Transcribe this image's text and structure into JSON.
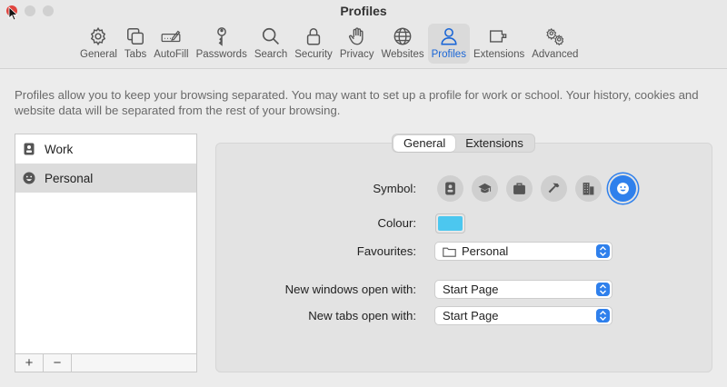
{
  "window": {
    "title": "Profiles"
  },
  "toolbar": {
    "items": [
      {
        "label": "General",
        "icon": "gear-icon"
      },
      {
        "label": "Tabs",
        "icon": "tabs-icon"
      },
      {
        "label": "AutoFill",
        "icon": "pencil-field-icon"
      },
      {
        "label": "Passwords",
        "icon": "key-icon"
      },
      {
        "label": "Search",
        "icon": "magnifier-icon"
      },
      {
        "label": "Security",
        "icon": "lock-icon"
      },
      {
        "label": "Privacy",
        "icon": "hand-icon"
      },
      {
        "label": "Websites",
        "icon": "globe-icon"
      },
      {
        "label": "Profiles",
        "icon": "person-icon"
      },
      {
        "label": "Extensions",
        "icon": "puzzle-icon"
      },
      {
        "label": "Advanced",
        "icon": "gears-icon"
      }
    ],
    "active": "Profiles"
  },
  "description": "Profiles allow you to keep your browsing separated. You may want to set up a profile for work or school. Your history, cookies and website data will be separated from the rest of your browsing.",
  "profiles": {
    "items": [
      {
        "label": "Work",
        "icon": "id-badge-icon"
      },
      {
        "label": "Personal",
        "icon": "smiley-icon"
      }
    ],
    "selected": "Personal",
    "add_label": "+",
    "remove_label": "−"
  },
  "tabs": {
    "general": "General",
    "extensions": "Extensions",
    "active": "General"
  },
  "settings": {
    "symbol_label": "Symbol:",
    "symbols": [
      "id-badge-icon",
      "graduation-cap-icon",
      "briefcase-icon",
      "hammer-icon",
      "building-icon",
      "smiley-icon"
    ],
    "selected_symbol": "smiley-icon",
    "colour_label": "Colour:",
    "colour_value": "#4cc7ef",
    "favourites_label": "Favourites:",
    "favourites_value": "Personal",
    "new_windows_label": "New windows open with:",
    "new_windows_value": "Start Page",
    "new_tabs_label": "New tabs open with:",
    "new_tabs_value": "Start Page"
  },
  "colors": {
    "accent": "#2f80ec",
    "close_button": "#e0443e"
  }
}
